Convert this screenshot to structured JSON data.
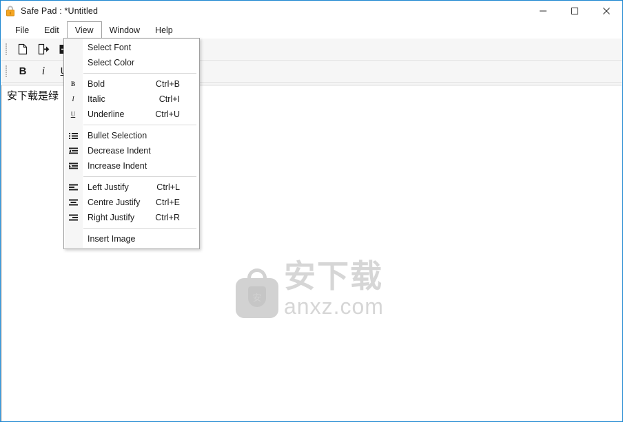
{
  "window": {
    "title": "Safe Pad : *Untitled",
    "app_icon": "lock-icon",
    "accent_color": "#1b86d0",
    "controls": {
      "minimize": "─",
      "maximize": "☐",
      "close": "✕"
    }
  },
  "menubar": {
    "items": [
      {
        "label": "File",
        "active": false
      },
      {
        "label": "Edit",
        "active": false
      },
      {
        "label": "View",
        "active": true
      },
      {
        "label": "Window",
        "active": false
      },
      {
        "label": "Help",
        "active": false
      }
    ]
  },
  "toolbar": {
    "row1": [
      {
        "name": "new-file-icon",
        "glyph": "὜B"
      },
      {
        "name": "open-file-icon",
        "glyph": "⮞"
      },
      {
        "name": "save-file-icon",
        "glyph": "⮞"
      }
    ],
    "row2": [
      {
        "name": "bold-button",
        "glyph": "B"
      },
      {
        "name": "italic-button",
        "glyph": "i"
      },
      {
        "name": "underline-button",
        "glyph": "U"
      }
    ]
  },
  "document": {
    "text": "安下载是绿"
  },
  "watermark": {
    "shield_char": "安",
    "cn_text": "安下载",
    "domain": "anxz.com",
    "color": "#d6d6d6"
  },
  "view_menu": {
    "groups": [
      {
        "items": [
          {
            "icon": "",
            "label": "Select Font",
            "shortcut": ""
          },
          {
            "icon": "",
            "label": "Select Color",
            "shortcut": ""
          }
        ]
      },
      {
        "items": [
          {
            "icon": "bold-icon",
            "label": "Bold",
            "shortcut": "Ctrl+B"
          },
          {
            "icon": "italic-icon",
            "label": "Italic",
            "shortcut": "Ctrl+I"
          },
          {
            "icon": "underline-icon",
            "label": "Underline",
            "shortcut": "Ctrl+U"
          }
        ]
      },
      {
        "items": [
          {
            "icon": "bullet-list-icon",
            "label": "Bullet Selection",
            "shortcut": ""
          },
          {
            "icon": "decrease-indent-icon",
            "label": "Decrease Indent",
            "shortcut": ""
          },
          {
            "icon": "increase-indent-icon",
            "label": "Increase Indent",
            "shortcut": ""
          }
        ]
      },
      {
        "items": [
          {
            "icon": "align-left-icon",
            "label": "Left Justify",
            "shortcut": "Ctrl+L"
          },
          {
            "icon": "align-center-icon",
            "label": "Centre Justify",
            "shortcut": "Ctrl+E"
          },
          {
            "icon": "align-right-icon",
            "label": "Right Justify",
            "shortcut": "Ctrl+R"
          }
        ]
      },
      {
        "items": [
          {
            "icon": "",
            "label": "Insert Image",
            "shortcut": ""
          }
        ]
      }
    ]
  }
}
